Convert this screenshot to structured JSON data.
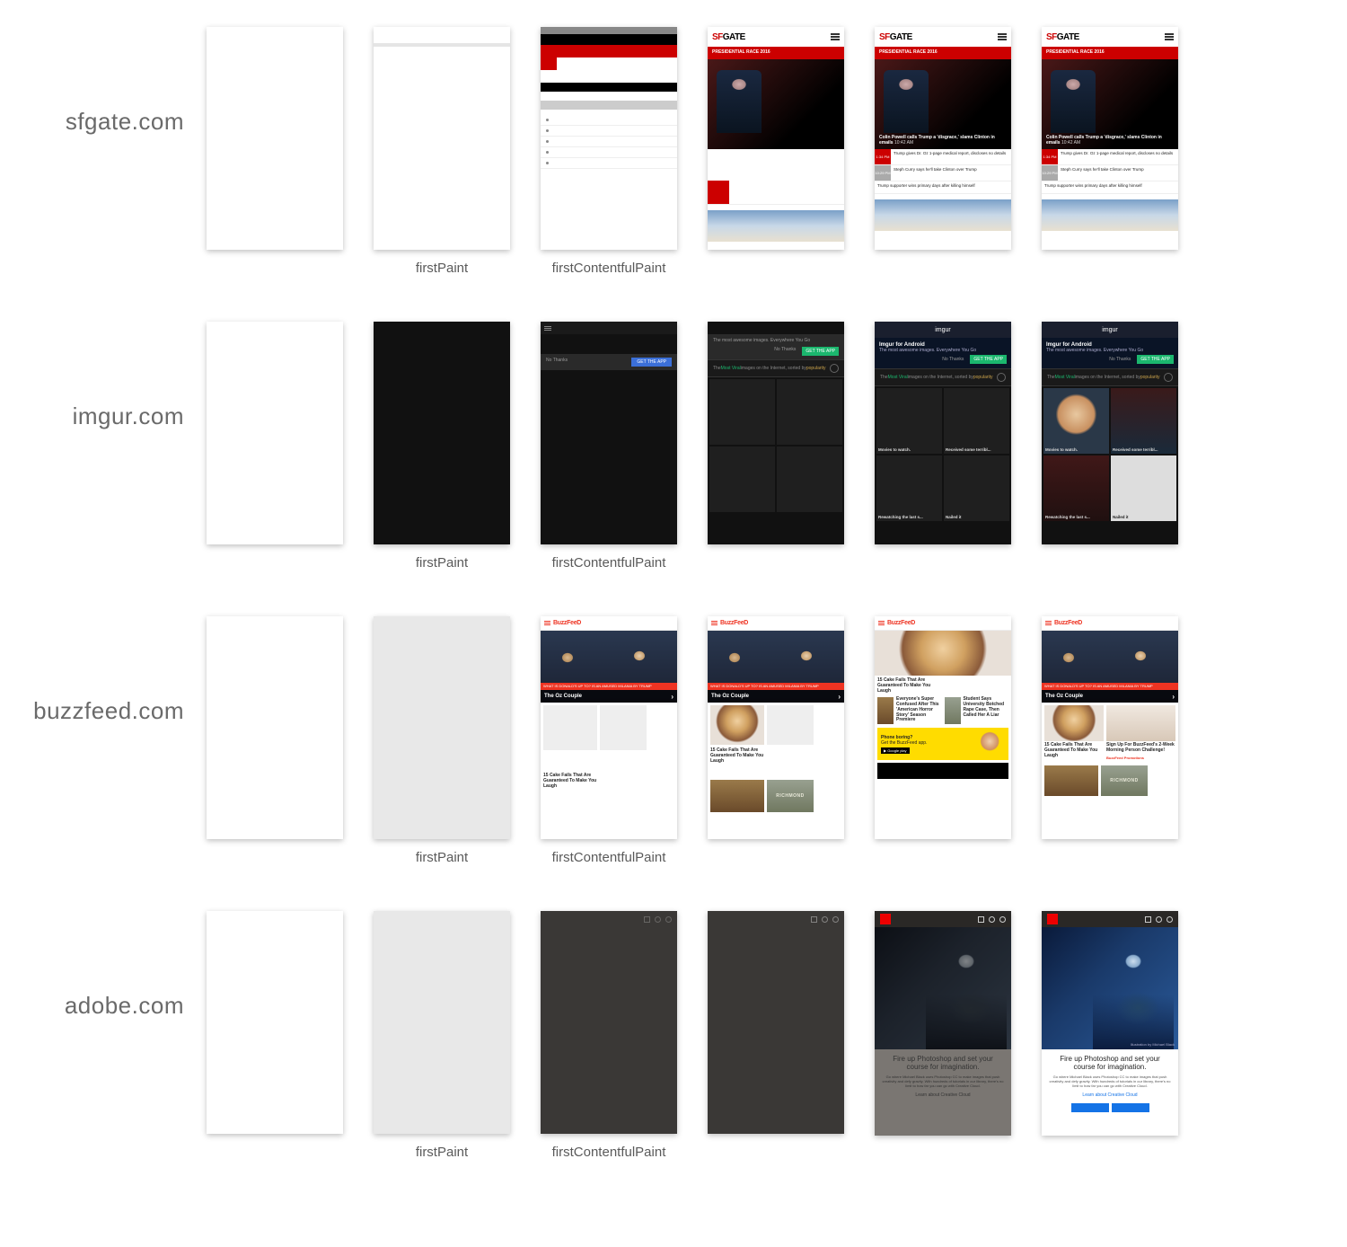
{
  "labels": {
    "firstPaint": "firstPaint",
    "firstContentfulPaint": "firstContentfulPaint"
  },
  "sites": [
    "sfgate.com",
    "imgur.com",
    "buzzfeed.com",
    "adobe.com"
  ],
  "sfgate": {
    "logo_sf": "SF",
    "logo_gate": "GATE",
    "section": "PRESIDENTIAL RACE 2016",
    "hero_headline": "Colin Powell calls Trump a 'disgrace,' slams Clinton in emails",
    "hero_time": "10:42 AM",
    "items": [
      {
        "time": "1:34 PM",
        "text": "Trump gives Dr. Oz 1-page medical report, discloses no details"
      },
      {
        "time": "10:29 PM",
        "text": "Steph Curry says he'll take Clinton over Trump"
      },
      {
        "time": "",
        "text": "Trump supporter wins primary days after killing himself"
      }
    ]
  },
  "imgur": {
    "brand": "imgur",
    "banner_title": "Imgur for Android",
    "banner_sub": "The most awesome images. Everywhere You Go",
    "prompt_text": "The most awesome images. Everywhere You Go",
    "btn_no": "No Thanks",
    "btn_get": "GET THE APP",
    "sort_prefix": "The ",
    "sort_most": "Most Viral",
    "sort_mid": " images on the Internet, sorted by ",
    "sort_pop": "popularity",
    "tiles": [
      "Movies to watch.",
      "Received some terribl...",
      "Rewatching the last s...",
      "Nailed it"
    ]
  },
  "buzzfeed": {
    "logo": "BuzzFeeD",
    "strip": "WHAT IS DONALD'S UP TO? IS AN AMUSED MILANIA BY TRUMP",
    "hero_title": "The Oz Couple",
    "cake_title": "15 Cake Fails That Are Guaranteed To Make You Laugh",
    "story_a": "Everyone's Super Confused After This 'American Horror Story' Season Premiere",
    "story_b": "Student Says University Botched Rape Case, Then Called Her A Liar",
    "ad_title": "Phone boring?",
    "ad_sub": "Get the BuzzFeed app.",
    "rich_label": "RICHMOND",
    "signup_title": "Sign Up For BuzzFeed's 2-Week Morning Person Challenge!",
    "signup_brand": "BuzzFeed Promotions"
  },
  "adobe": {
    "hero_credit": "Illustration by Michael Black",
    "headline": "Fire up Photoshop and set your course for imagination.",
    "body": "Go where Michael Black uses Photoshop CC to make images that push creativity and defy gravity. With hundreds of tutorials in our library, there's no limit to how far you can go with Creative Cloud.",
    "link": "Learn about Creative Cloud"
  }
}
